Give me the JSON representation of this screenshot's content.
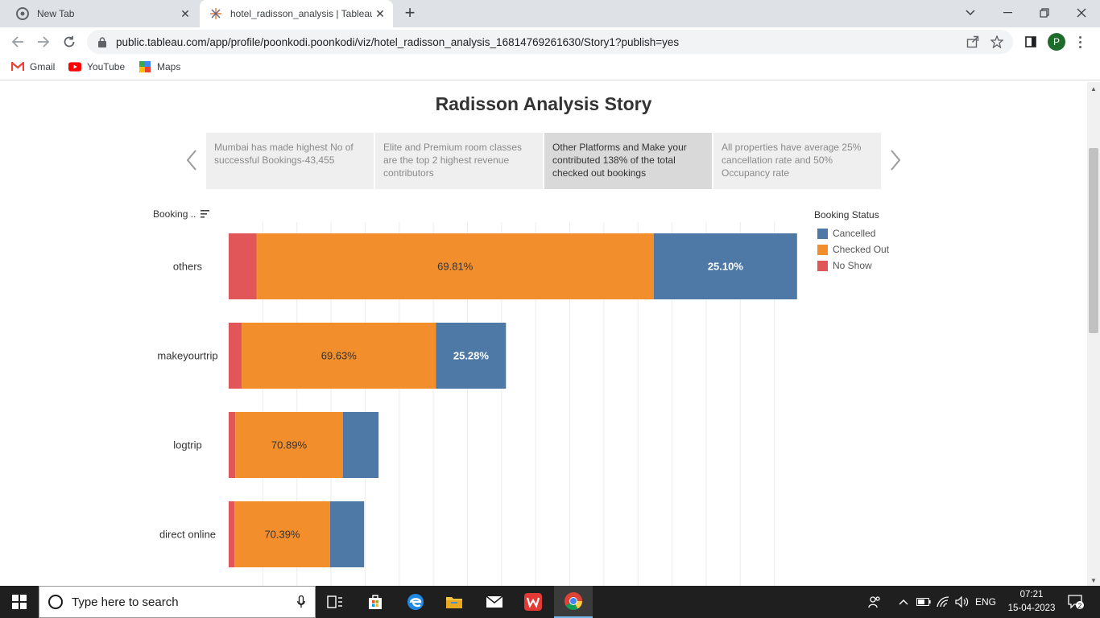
{
  "browser": {
    "tabs": [
      {
        "title": "New Tab",
        "active": false
      },
      {
        "title": "hotel_radisson_analysis | Tableau",
        "active": true
      }
    ],
    "url": "public.tableau.com/app/profile/poonkodi.poonkodi/viz/hotel_radisson_analysis_16814769261630/Story1?publish=yes",
    "profile_initial": "P",
    "bookmarks": [
      "Gmail",
      "YouTube",
      "Maps"
    ]
  },
  "story": {
    "title": "Radisson Analysis Story",
    "points": [
      {
        "text": "Mumbai has made highest No of successful Bookings-43,455",
        "active": false
      },
      {
        "text": "Elite and Premium room classes are the top 2 highest revenue contributors",
        "active": false
      },
      {
        "text": "Other Platforms and Make your contributed  138% of the total checked out bookings",
        "active": true
      },
      {
        "text": "All properties have average 25% cancellation rate and 50% Occupancy rate",
        "active": false
      }
    ]
  },
  "sort_label": "Booking ..",
  "legend": {
    "title": "Booking Status",
    "items": [
      {
        "label": "Cancelled",
        "color": "#4e79a7"
      },
      {
        "label": "Checked Out",
        "color": "#f28e2b"
      },
      {
        "label": "No Show",
        "color": "#e15759"
      }
    ]
  },
  "chart_data": {
    "type": "bar",
    "orientation": "horizontal",
    "stacked": true,
    "categories": [
      "others",
      "makeyourtrip",
      "logtrip",
      "direct online"
    ],
    "series": [
      {
        "name": "No Show",
        "color": "#e15759",
        "values": [
          1.63,
          0.76,
          0.39,
          0.34
        ]
      },
      {
        "name": "Checked Out",
        "color": "#f28e2b",
        "values": [
          23.3,
          11.4,
          6.3,
          5.6
        ]
      },
      {
        "name": "Cancelled",
        "color": "#4e79a7",
        "values": [
          8.4,
          4.1,
          2.1,
          2.0
        ]
      }
    ],
    "data_labels": [
      {
        "category": "others",
        "series": "Checked Out",
        "text": "69.81%"
      },
      {
        "category": "others",
        "series": "Cancelled",
        "text": "25.10%"
      },
      {
        "category": "makeyourtrip",
        "series": "Checked Out",
        "text": "69.63%"
      },
      {
        "category": "makeyourtrip",
        "series": "Cancelled",
        "text": "25.28%"
      },
      {
        "category": "logtrip",
        "series": "Checked Out",
        "text": "70.89%"
      },
      {
        "category": "direct online",
        "series": "Checked Out",
        "text": "70.39%"
      }
    ],
    "xlim": [
      0,
      34
    ],
    "grid": true,
    "legend_position": "right"
  },
  "taskbar": {
    "search_placeholder": "Type here to search",
    "language": "ENG",
    "time": "07:21",
    "date": "15-04-2023",
    "notification_count": "2"
  }
}
